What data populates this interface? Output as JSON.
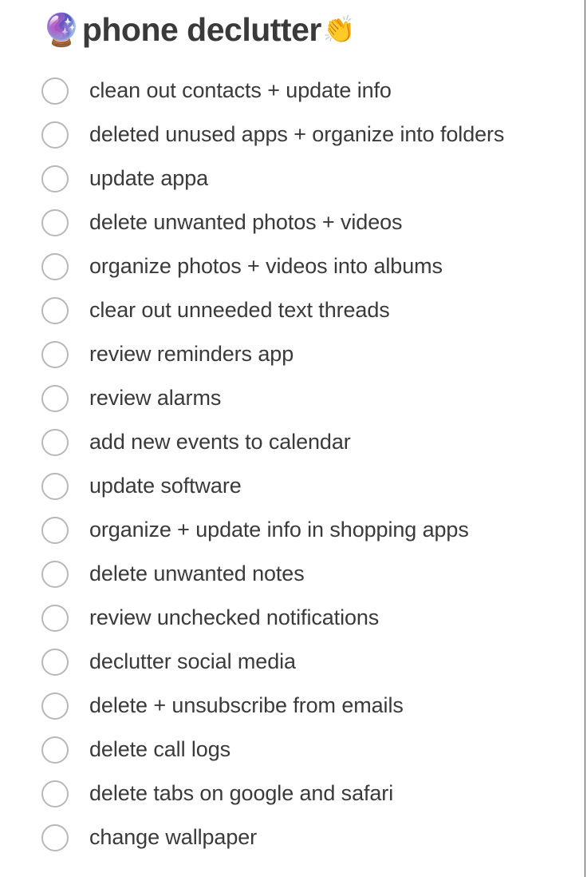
{
  "page": {
    "background_color": "#ffffff",
    "text_color": "#3a3a3a",
    "checkbox_border_color": "#b8b8b8"
  },
  "header": {
    "emoji_left": "🔮",
    "emoji_left_name": "crystal-ball-emoji",
    "title": "phone declutter",
    "emoji_right": "👏",
    "emoji_right_name": "clapping-hands-emoji"
  },
  "checklist": {
    "items": [
      {
        "label": "clean out contacts + update info",
        "checked": false
      },
      {
        "label": "deleted unused apps + organize into folders",
        "checked": false
      },
      {
        "label": "update appa",
        "checked": false
      },
      {
        "label": "delete unwanted photos + videos",
        "checked": false
      },
      {
        "label": "organize photos + videos into albums",
        "checked": false
      },
      {
        "label": "clear out unneeded text threads",
        "checked": false
      },
      {
        "label": "review reminders app",
        "checked": false
      },
      {
        "label": "review alarms",
        "checked": false
      },
      {
        "label": "add new events to calendar",
        "checked": false
      },
      {
        "label": "update software",
        "checked": false
      },
      {
        "label": "organize + update info in shopping apps",
        "checked": false
      },
      {
        "label": "delete unwanted notes",
        "checked": false
      },
      {
        "label": "review unchecked notifications",
        "checked": false
      },
      {
        "label": "declutter social media",
        "checked": false
      },
      {
        "label": "delete + unsubscribe from emails",
        "checked": false
      },
      {
        "label": "delete call logs",
        "checked": false
      },
      {
        "label": "delete tabs on google and safari",
        "checked": false
      },
      {
        "label": "change wallpaper",
        "checked": false
      }
    ]
  }
}
